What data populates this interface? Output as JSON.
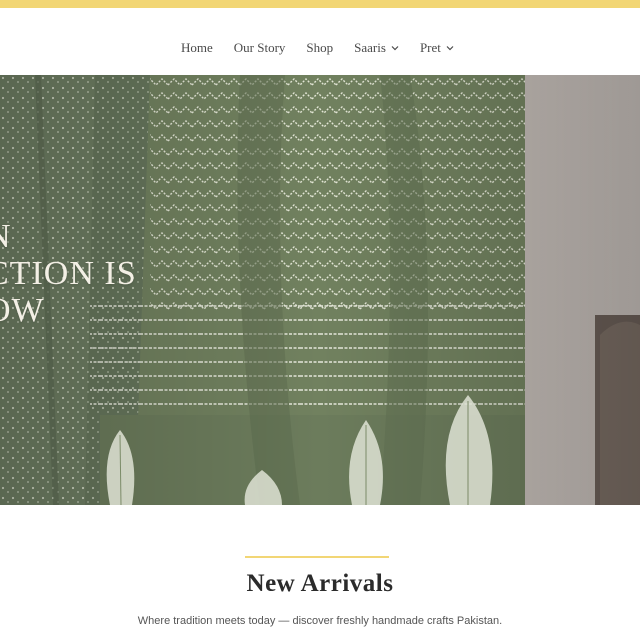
{
  "colors": {
    "accent": "#f2d675",
    "hero_fabric": "#6f7f64",
    "hero_text": "#f3efe5"
  },
  "nav": {
    "items": [
      {
        "label": "Home",
        "has_dropdown": false
      },
      {
        "label": "Our Story",
        "has_dropdown": false
      },
      {
        "label": "Shop",
        "has_dropdown": false
      },
      {
        "label": "Saaris",
        "has_dropdown": true,
        "icon": "chevron-down-icon"
      },
      {
        "label": "Pret",
        "has_dropdown": true,
        "icon": "chevron-down-icon"
      }
    ]
  },
  "hero": {
    "lines": [
      "N",
      "CTION IS",
      "OW"
    ]
  },
  "section": {
    "title": "New Arrivals",
    "subtitle": "Where tradition meets today — discover freshly handmade crafts Pakistan."
  }
}
